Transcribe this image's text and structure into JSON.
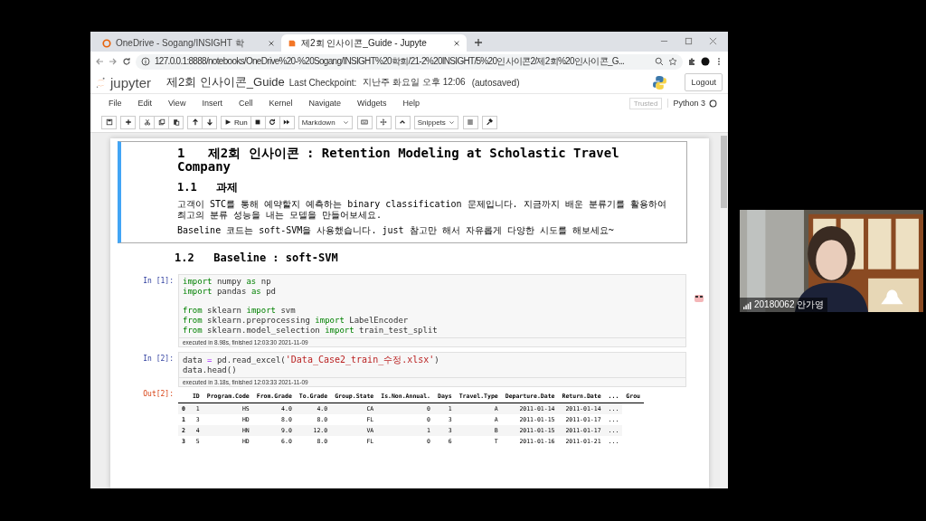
{
  "browser": {
    "tabs": [
      {
        "title": "OneDrive - Sogang/INSIGHT 학",
        "kind": "onedrive",
        "selected": false
      },
      {
        "title": "제2회 인사이콘_Guide - Jupyte",
        "kind": "jupyter",
        "selected": true
      }
    ],
    "address": "127.0.0.1:8888/notebooks/OneDrive%20-%20Sogang/INSIGHT%20학회/21-2%20INSIGHT/5%20인사이콘2/제2회%20인사이콘_G..."
  },
  "notebook": {
    "logo": "jupyter",
    "name": "제2회 인사이콘_Guide",
    "checkpoint_label": "Last Checkpoint:",
    "checkpoint": "지난주 화요일 오후 12:06",
    "autosaved": "(autosaved)",
    "logout": "Logout",
    "menu": [
      "File",
      "Edit",
      "View",
      "Insert",
      "Cell",
      "Kernel",
      "Navigate",
      "Widgets",
      "Help"
    ],
    "trusted": "Trusted",
    "kernel": "Python 3",
    "toolbar": {
      "run": "Run",
      "cell_type": "Markdown",
      "snippets": "Snippets"
    },
    "cells": [
      {
        "kind": "markdown",
        "selected": true,
        "blocks": [
          {
            "kind": "h1",
            "number": "1",
            "text": "제2회 인사이콘 : Retention Modeling at Scholastic Travel Company"
          },
          {
            "kind": "h2",
            "number": "1.1",
            "text": "과제"
          },
          {
            "kind": "p",
            "text": "고객이 STC를 통해 예약할지 예측하는 binary classification 문제입니다. 지금까지 배운 분류기를 활용하여 최고의 분류 성능을 내는 모델을 만들어보세요."
          },
          {
            "kind": "p",
            "text": "Baseline 코드는 soft-SVM을 사용했습니다. just 참고만 해서 자유롭게 다양한 시도를 해보세요~"
          }
        ]
      },
      {
        "kind": "markdown",
        "selected": false,
        "blocks": [
          {
            "kind": "h2",
            "number": "1.2",
            "text": "Baseline : soft-SVM"
          }
        ]
      },
      {
        "kind": "code",
        "selected": false,
        "prompt": "In [1]:",
        "groups": [
          [
            [
              {
                "kind": "keyword",
                "t": "import"
              },
              {
                "kind": "name",
                "t": " numpy "
              },
              {
                "kind": "keyword",
                "t": "as"
              },
              {
                "kind": "name",
                "t": " np"
              }
            ],
            [
              {
                "kind": "keyword",
                "t": "import"
              },
              {
                "kind": "name",
                "t": " pandas "
              },
              {
                "kind": "keyword",
                "t": "as"
              },
              {
                "kind": "name",
                "t": " pd"
              }
            ]
          ],
          [
            [
              {
                "kind": "keyword",
                "t": "from"
              },
              {
                "kind": "name",
                "t": " sklearn "
              },
              {
                "kind": "keyword",
                "t": "import"
              },
              {
                "kind": "name",
                "t": " svm"
              }
            ],
            [
              {
                "kind": "keyword",
                "t": "from"
              },
              {
                "kind": "name",
                "t": " sklearn.preprocessing "
              },
              {
                "kind": "keyword",
                "t": "import"
              },
              {
                "kind": "name",
                "t": " LabelEncoder"
              }
            ],
            [
              {
                "kind": "keyword",
                "t": "from"
              },
              {
                "kind": "name",
                "t": " sklearn.model_selection "
              },
              {
                "kind": "keyword",
                "t": "import"
              },
              {
                "kind": "name",
                "t": " train_test_split"
              }
            ]
          ]
        ],
        "executed": "executed in 8.98s, finished 12:03:30 2021-11-09"
      },
      {
        "kind": "code",
        "selected": false,
        "prompt": "In [2]:",
        "groups": [
          [
            [
              {
                "kind": "name",
                "t": "data "
              },
              {
                "kind": "operator",
                "t": "="
              },
              {
                "kind": "name",
                "t": " pd.read_excel("
              },
              {
                "kind": "string",
                "t": "'Data_Case2_train_수정.xlsx'"
              },
              {
                "kind": "name",
                "t": ")"
              }
            ],
            [
              {
                "kind": "name",
                "t": "data.head()"
              }
            ]
          ]
        ],
        "executed": "executed in 3.18s, finished 12:03:33 2021-11-09",
        "output": {
          "prompt": "Out[2]:",
          "columns": [
            "ID",
            "Program.Code",
            "From.Grade",
            "To.Grade",
            "Group.State",
            "Is.Non.Annual.",
            "Days",
            "Travel.Type",
            "Departure.Date",
            "Return.Date",
            "...",
            "Grou"
          ],
          "rows": [
            {
              "index": "0",
              "cells": [
                "1",
                "HS",
                "4.0",
                "4.0",
                "CA",
                "0",
                "1",
                "A",
                "2011-01-14",
                "2011-01-14",
                "..."
              ]
            },
            {
              "index": "1",
              "cells": [
                "3",
                "HD",
                "8.0",
                "8.0",
                "FL",
                "0",
                "3",
                "A",
                "2011-01-15",
                "2011-01-17",
                "..."
              ]
            },
            {
              "index": "2",
              "cells": [
                "4",
                "HN",
                "9.0",
                "12.0",
                "VA",
                "1",
                "3",
                "B",
                "2011-01-15",
                "2011-01-17",
                "..."
              ]
            },
            {
              "index": "3",
              "cells": [
                "5",
                "HD",
                "6.0",
                "8.0",
                "FL",
                "0",
                "6",
                "T",
                "2011-01-16",
                "2011-01-21",
                "..."
              ]
            }
          ]
        }
      }
    ]
  },
  "participant": {
    "name": "20180062 안가영"
  }
}
